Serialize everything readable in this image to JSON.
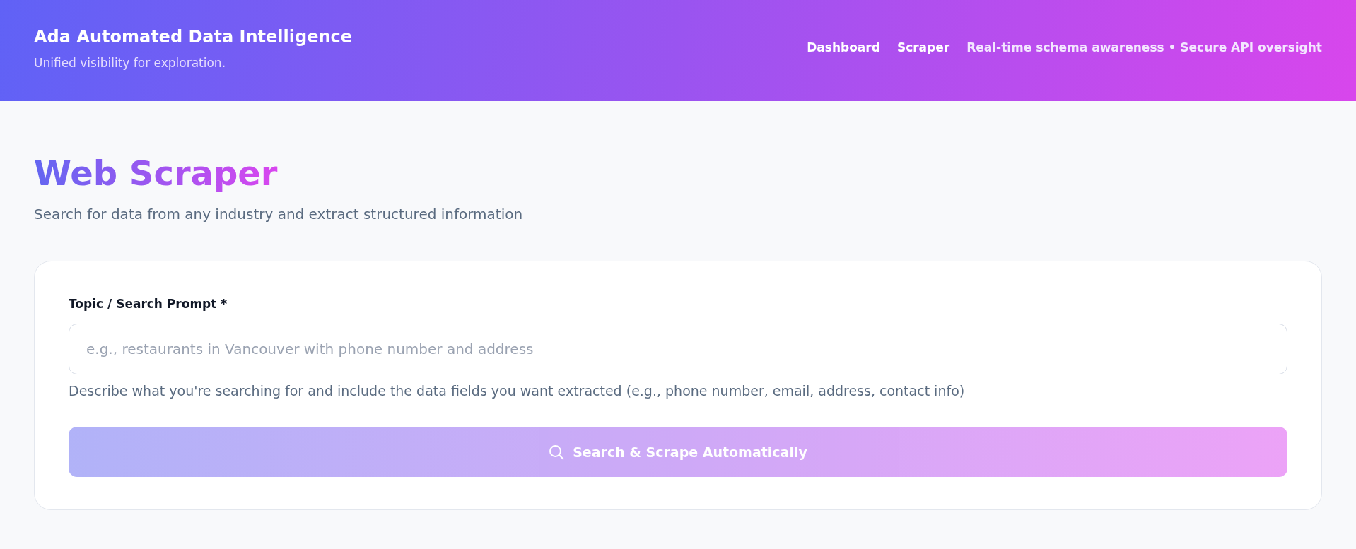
{
  "header": {
    "title": "Ada Automated Data Intelligence",
    "subtitle": "Unified visibility for exploration.",
    "nav": [
      {
        "label": "Dashboard"
      },
      {
        "label": "Scraper"
      }
    ],
    "tagline": "Real-time schema awareness • Secure API oversight"
  },
  "page": {
    "title": "Web Scraper",
    "subtitle": "Search for data from any industry and extract structured information"
  },
  "form": {
    "field": {
      "label": "Topic / Search Prompt *",
      "placeholder": "e.g., restaurants in Vancouver with phone number and address",
      "help": "Describe what you're searching for and include the data fields you want extracted (e.g., phone number, email, address, contact info)"
    },
    "submit": {
      "label": "Search & Scrape Automatically",
      "disabled": true
    }
  }
}
